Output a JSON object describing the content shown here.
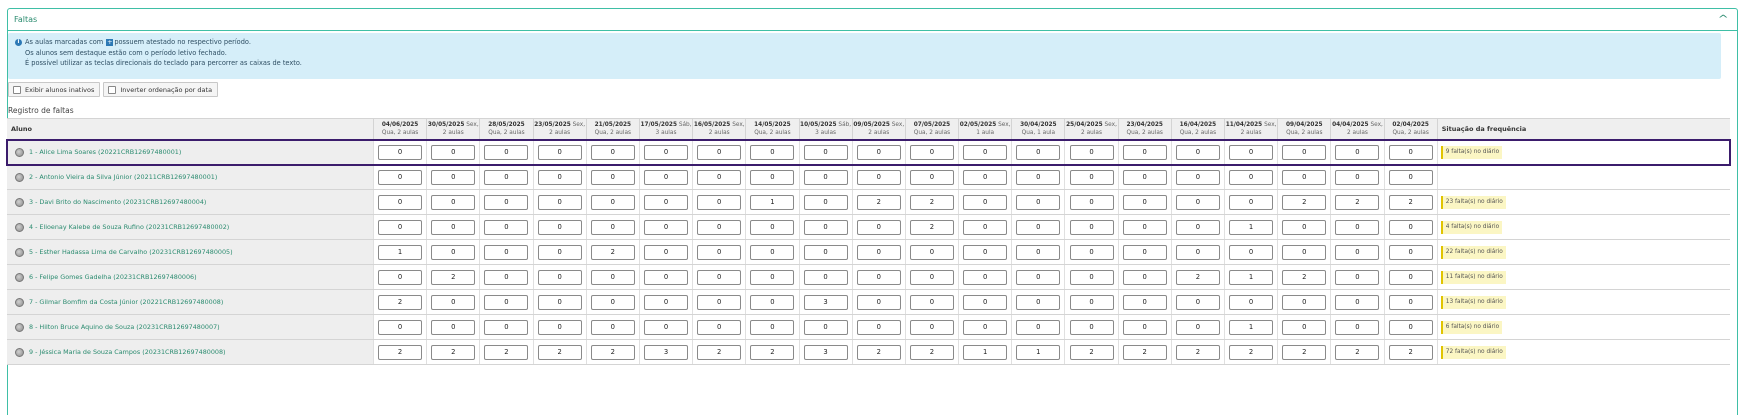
{
  "panel": {
    "title": "Faltas",
    "chevron": "chevron-up-icon"
  },
  "info": {
    "line1_pre": "As aulas marcadas com",
    "line1_post": "possuem atestado no respectivo período.",
    "line2": "Os alunos sem destaque estão com o período letivo fechado.",
    "line3": "É possível utilizar as teclas direcionais do teclado para percorrer as caixas de texto."
  },
  "buttons": {
    "inactive": "Exibir alunos inativos",
    "reverse": "Inverter ordenação por data"
  },
  "section_title": "Registro de faltas",
  "table": {
    "student_header": "Aluno",
    "status_header": "Situação da frequência",
    "dates": [
      {
        "date": "04/06/2025",
        "inline": "",
        "sub": "Qua, 2 aulas"
      },
      {
        "date": "30/05/2025",
        "inline": "Sex,",
        "sub": "2 aulas"
      },
      {
        "date": "28/05/2025",
        "inline": "",
        "sub": "Qua, 2 aulas"
      },
      {
        "date": "23/05/2025",
        "inline": "Sex,",
        "sub": "2 aulas"
      },
      {
        "date": "21/05/2025",
        "inline": "",
        "sub": "Qua, 2 aulas"
      },
      {
        "date": "17/05/2025",
        "inline": "Sáb,",
        "sub": "3 aulas"
      },
      {
        "date": "16/05/2025",
        "inline": "Sex,",
        "sub": "2 aulas"
      },
      {
        "date": "14/05/2025",
        "inline": "",
        "sub": "Qua, 2 aulas"
      },
      {
        "date": "10/05/2025",
        "inline": "Sáb,",
        "sub": "3 aulas"
      },
      {
        "date": "09/05/2025",
        "inline": "Sex,",
        "sub": "2 aulas"
      },
      {
        "date": "07/05/2025",
        "inline": "",
        "sub": "Qua, 2 aulas"
      },
      {
        "date": "02/05/2025",
        "inline": "Sex,",
        "sub": "1 aula"
      },
      {
        "date": "30/04/2025",
        "inline": "",
        "sub": "Qua, 1 aula"
      },
      {
        "date": "25/04/2025",
        "inline": "Sex,",
        "sub": "2 aulas"
      },
      {
        "date": "23/04/2025",
        "inline": "",
        "sub": "Qua, 2 aulas"
      },
      {
        "date": "16/04/2025",
        "inline": "",
        "sub": "Qua, 2 aulas"
      },
      {
        "date": "11/04/2025",
        "inline": "Sex,",
        "sub": "2 aulas"
      },
      {
        "date": "09/04/2025",
        "inline": "",
        "sub": "Qua, 2 aulas"
      },
      {
        "date": "04/04/2025",
        "inline": "Sex,",
        "sub": "2 aulas"
      },
      {
        "date": "02/04/2025",
        "inline": "",
        "sub": "Qua, 2 aulas"
      }
    ],
    "rows": [
      {
        "name": "1 - Alice Lima Soares (20221CRB12697480001)",
        "values": [
          "0",
          "0",
          "0",
          "0",
          "0",
          "0",
          "0",
          "0",
          "0",
          "0",
          "0",
          "0",
          "0",
          "0",
          "0",
          "0",
          "0",
          "0",
          "0",
          "0"
        ],
        "status": "9 falta(s) no diário",
        "selected": true
      },
      {
        "name": "2 - Antonio Vieira da Silva Júnior (20211CRB12697480001)",
        "values": [
          "0",
          "0",
          "0",
          "0",
          "0",
          "0",
          "0",
          "0",
          "0",
          "0",
          "0",
          "0",
          "0",
          "0",
          "0",
          "0",
          "0",
          "0",
          "0",
          "0"
        ],
        "status": ""
      },
      {
        "name": "3 - Davi Brito do Nascimento (20231CRB12697480004)",
        "values": [
          "0",
          "0",
          "0",
          "0",
          "0",
          "0",
          "0",
          "1",
          "0",
          "2",
          "2",
          "0",
          "0",
          "0",
          "0",
          "0",
          "0",
          "2",
          "2",
          "2"
        ],
        "status": "23 falta(s) no diário"
      },
      {
        "name": "4 - Elioenay Kalebe de Souza Rufino (20231CRB12697480002)",
        "values": [
          "0",
          "0",
          "0",
          "0",
          "0",
          "0",
          "0",
          "0",
          "0",
          "0",
          "2",
          "0",
          "0",
          "0",
          "0",
          "0",
          "1",
          "0",
          "0",
          "0"
        ],
        "status": "4 falta(s) no diário"
      },
      {
        "name": "5 - Esther Hadassa Lima de Carvalho (20231CRB12697480005)",
        "values": [
          "1",
          "0",
          "0",
          "0",
          "2",
          "0",
          "0",
          "0",
          "0",
          "0",
          "0",
          "0",
          "0",
          "0",
          "0",
          "0",
          "0",
          "0",
          "0",
          "0"
        ],
        "status": "22 falta(s) no diário"
      },
      {
        "name": "6 - Felipe Gomes Gadelha (20231CRB12697480006)",
        "values": [
          "0",
          "2",
          "0",
          "0",
          "0",
          "0",
          "0",
          "0",
          "0",
          "0",
          "0",
          "0",
          "0",
          "0",
          "0",
          "2",
          "1",
          "2",
          "0",
          "0"
        ],
        "status": "11 falta(s) no diário"
      },
      {
        "name": "7 - Gilmar Bomfim da Costa Júnior (20221CRB12697480008)",
        "values": [
          "2",
          "0",
          "0",
          "0",
          "0",
          "0",
          "0",
          "0",
          "3",
          "0",
          "0",
          "0",
          "0",
          "0",
          "0",
          "0",
          "0",
          "0",
          "0",
          "0"
        ],
        "status": "13 falta(s) no diário"
      },
      {
        "name": "8 - Hilton Bruce Aquino de Souza (20231CRB12697480007)",
        "values": [
          "0",
          "0",
          "0",
          "0",
          "0",
          "0",
          "0",
          "0",
          "0",
          "0",
          "0",
          "0",
          "0",
          "0",
          "0",
          "0",
          "1",
          "0",
          "0",
          "0"
        ],
        "status": "6 falta(s) no diário"
      },
      {
        "name": "9 - Jéssica Maria de Souza Campos (20231CRB12697480008)",
        "values": [
          "2",
          "2",
          "2",
          "2",
          "2",
          "3",
          "2",
          "2",
          "3",
          "2",
          "2",
          "1",
          "1",
          "2",
          "2",
          "2",
          "2",
          "2",
          "2",
          "2"
        ],
        "status": "72 falta(s) no diário"
      }
    ]
  }
}
